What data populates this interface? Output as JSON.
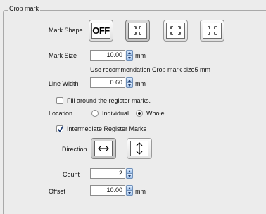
{
  "group": {
    "title": "Crop mark"
  },
  "mark_shape": {
    "label": "Mark Shape",
    "options": [
      {
        "name": "off",
        "text": "OFF",
        "selected": false
      },
      {
        "name": "inner-corners",
        "selected": true
      },
      {
        "name": "outer-corners",
        "selected": false
      },
      {
        "name": "double-corners",
        "selected": false
      }
    ]
  },
  "mark_size": {
    "label": "Mark Size",
    "value": "10.00",
    "unit": "mm",
    "hint": "Use recommendation Crop mark size5 mm"
  },
  "line_width": {
    "label": "Line Width",
    "value": "0.60",
    "unit": "mm"
  },
  "fill_register": {
    "label": "Fill around the register marks.",
    "checked": false
  },
  "location": {
    "label": "Location",
    "options": [
      {
        "label": "Individual",
        "selected": false
      },
      {
        "label": "Whole",
        "selected": true
      }
    ]
  },
  "intermediate": {
    "label": "Intermediate Register Marks",
    "checked": true
  },
  "direction": {
    "label": "Direction",
    "options": [
      {
        "name": "horizontal",
        "icon": "horizontal-arrow-icon",
        "selected": true
      },
      {
        "name": "vertical",
        "icon": "vertical-arrow-icon",
        "selected": false
      }
    ]
  },
  "count": {
    "label": "Count",
    "value": "2"
  },
  "offset": {
    "label": "Offset",
    "value": "10.00",
    "unit": "mm"
  }
}
